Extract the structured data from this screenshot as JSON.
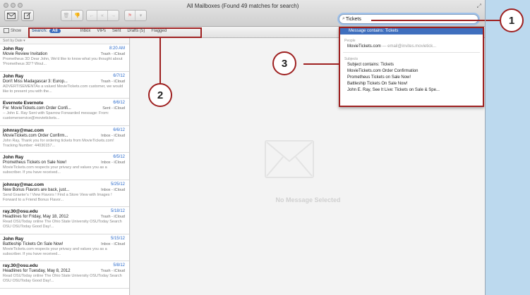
{
  "window": {
    "title": "All Mailboxes (Found 49 matches for search)"
  },
  "toolbar": {
    "get_mail_icon": "envelope-icon",
    "compose_icon": "compose-icon",
    "search_value": "Tickets"
  },
  "scope_bar": {
    "show_label": "Show",
    "search_label": "Search:",
    "all_label": "All",
    "items": [
      "Inbox",
      "VIPs",
      "Sent",
      "Drafts (5)",
      "Flagged"
    ]
  },
  "list": {
    "sort_label": "Sort by Date ▾",
    "messages": [
      {
        "sender": "John Ray",
        "date": "8:20 AM",
        "subject": "Movie Review Invitation",
        "mailbox": "Trash - iCloud",
        "preview": "Prometheus 3D Dear John, We'd like to know what you thought about 'Prometheus 3D'? Woul..."
      },
      {
        "sender": "John Ray",
        "date": "6/7/12",
        "subject": "Don't Miss Madagascar 3: Europ...",
        "mailbox": "Trash - iCloud",
        "preview": "ADVERTISEMENTAs a valued MovieTickets.com customer, we would like to present you with the..."
      },
      {
        "sender": "Evernote Evernote",
        "date": "6/6/12",
        "subject": "Fw: MovieTickets.com Order Confi...",
        "mailbox": "Sent - iCloud",
        "preview": "-- John E. Ray Sent with Sparrow Forwarded message: From: customerservice@movietickets..."
      },
      {
        "sender": "johnray@mac.com",
        "date": "6/6/12",
        "subject": "MovieTickets.com Order Confirm...",
        "mailbox": "Inbox - iCloud",
        "preview": "John Ray, Thank you for ordering tickets from MovieTickets.com! Tracking Number: 44030157..."
      },
      {
        "sender": "John Ray",
        "date": "6/5/12",
        "subject": "Prometheus Tickets on Sale Now!",
        "mailbox": "Inbox - iCloud",
        "preview": "MovieTickets.com respects your privacy and values you as a subscriber. If you have received..."
      },
      {
        "sender": "johnray@mac.com",
        "date": "5/25/12",
        "subject": "New Bonus Flavors are back, just...",
        "mailbox": "Inbox - iCloud",
        "preview": "Send Graeter's ! View Flavors ! Find a Store View with Images ! Forward to a Friend Bonus Flavor..."
      },
      {
        "sender": "ray.30@osu.edu",
        "date": "5/18/12",
        "subject": "Headlines for Friday, May 18, 2012",
        "mailbox": "Trash - iCloud",
        "preview": "Read OSUToday online The Ohio State University OSUToday Search OSU OSUToday Good Day!..."
      },
      {
        "sender": "John Ray",
        "date": "5/15/12",
        "subject": "Battleship Tickets On Sale Now!",
        "mailbox": "Inbox - iCloud",
        "preview": "MovieTickets.com respects your privacy and values you as a subscriber. If you have received..."
      },
      {
        "sender": "ray.30@osu.edu",
        "date": "5/8/12",
        "subject": "Headlines for Tuesday, May 8, 2012",
        "mailbox": "Trash - iCloud",
        "preview": "Read OSUToday online The Ohio State University OSUToday Search OSU OSUToday Good Day!..."
      }
    ]
  },
  "viewer": {
    "empty_text": "No Message Selected"
  },
  "suggestions": {
    "top": "Message contains: Tickets",
    "people_header": "People",
    "people": [
      {
        "name": "MovieTickets.com",
        "detail": " — email@invites.movietick..."
      }
    ],
    "subjects_header": "Subjects",
    "subjects": [
      "Subject contains: Tickets",
      "MovieTickets.com Order Confirmation",
      "Prometheus Tickets on Sale Now!",
      "Battleship Tickets On Sale Now!",
      "John E. Ray, See It Live: Tickets on Sale & Spe..."
    ]
  },
  "callouts": [
    "1",
    "2",
    "3"
  ],
  "colors": {
    "callout_red": "#9e2020",
    "selection_blue": "#3f6fbe",
    "date_blue": "#2a6acb",
    "background": "#bcd9ee"
  }
}
